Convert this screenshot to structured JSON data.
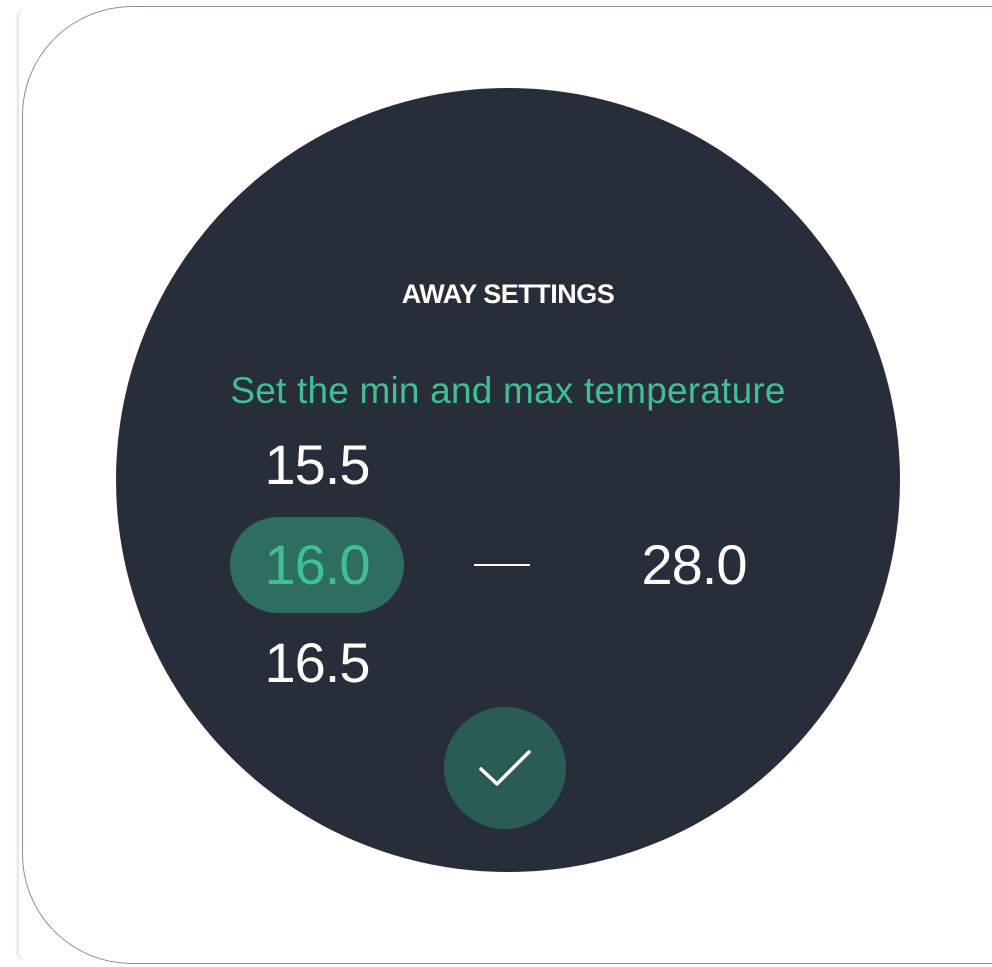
{
  "dialog": {
    "title": "AWAY SETTINGS",
    "subtitle": "Set the min and max temperature"
  },
  "min_picker": {
    "above": "15.5",
    "selected": "16.0",
    "below": "16.5"
  },
  "separator": "—",
  "max_value": "28.0",
  "confirm_icon": "checkmark-icon",
  "colors": {
    "dial_background": "#282d3a",
    "accent": "#3fbf94",
    "selected_background": "#2e6e61",
    "confirm_background": "#2b5b55"
  }
}
